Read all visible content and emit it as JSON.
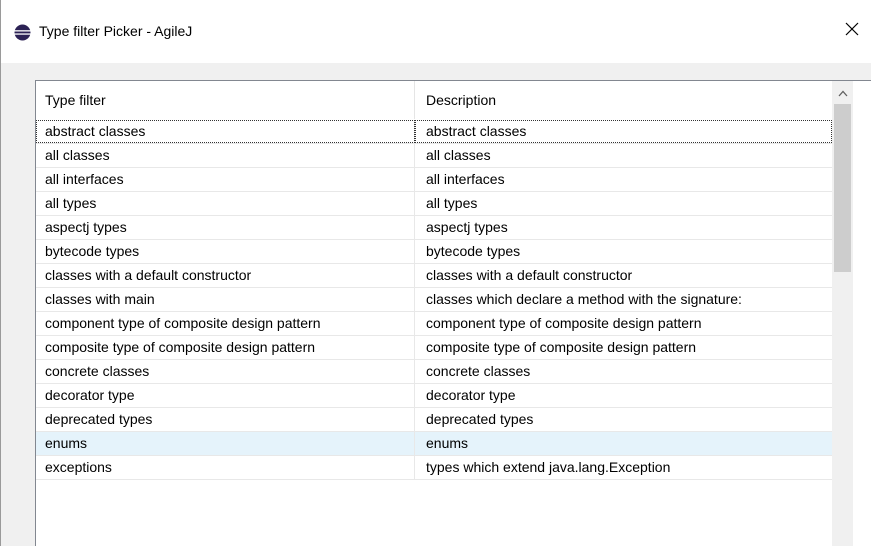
{
  "window": {
    "title": "Type filter Picker - AgileJ",
    "icon": "eclipse-icon"
  },
  "table": {
    "columns": [
      "Type filter",
      "Description"
    ],
    "focused_row": 0,
    "selected_row": 13,
    "rows": [
      {
        "type_filter": "abstract classes",
        "description": "abstract classes"
      },
      {
        "type_filter": "all classes",
        "description": "all classes"
      },
      {
        "type_filter": "all interfaces",
        "description": "all interfaces"
      },
      {
        "type_filter": "all types",
        "description": "all types"
      },
      {
        "type_filter": "aspectj types",
        "description": "aspectj types"
      },
      {
        "type_filter": "bytecode types",
        "description": "bytecode types"
      },
      {
        "type_filter": "classes with a default constructor",
        "description": "classes with a default constructor"
      },
      {
        "type_filter": "classes with main",
        "description": "classes which declare a method with the signature:"
      },
      {
        "type_filter": "component type of composite design pattern",
        "description": "component type of composite design pattern"
      },
      {
        "type_filter": "composite type of composite design pattern",
        "description": "composite type of composite design pattern"
      },
      {
        "type_filter": "concrete classes",
        "description": "concrete classes"
      },
      {
        "type_filter": "decorator type",
        "description": "decorator type"
      },
      {
        "type_filter": "deprecated types",
        "description": "deprecated types"
      },
      {
        "type_filter": "enums",
        "description": "enums"
      },
      {
        "type_filter": "exceptions",
        "description": "types which extend java.lang.Exception"
      }
    ]
  },
  "colors": {
    "selection": "#e5f3fb",
    "scroll_thumb": "#cdcdcd"
  }
}
